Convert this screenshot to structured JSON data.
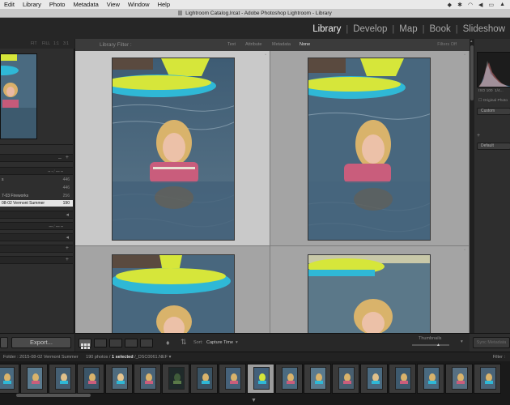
{
  "menubar": {
    "items": [
      "Edit",
      "Library",
      "Photo",
      "Metadata",
      "View",
      "Window",
      "Help"
    ]
  },
  "window": {
    "title": "Lightroom Catalog.lrcat - Adobe Photoshop Lightroom - Library"
  },
  "modules": [
    "Library",
    "Develop",
    "Map",
    "Book",
    "Slideshow"
  ],
  "active_module": "Library",
  "left_panel": {
    "folder_rows": [
      {
        "label": "s",
        "count": "446"
      },
      {
        "label": "",
        "count": "446"
      },
      {
        "label": "7-03 Fireworks",
        "count": "256"
      },
      {
        "label": "08-02 Vermont Summer",
        "count": "190",
        "selected": true
      }
    ]
  },
  "library_filter": {
    "label": "Library Filter :",
    "tabs": [
      "Text",
      "Attribute",
      "Metadata",
      "None"
    ],
    "active_tab": "None",
    "presets": "Filters Off"
  },
  "toolbar": {
    "sort_label": "Sort:",
    "sort_value": "Capture Time",
    "thumbnails_label": "Thumbnails"
  },
  "left_bottom": {
    "import_label": "",
    "export_label": "Export..."
  },
  "right_panel": {
    "histogram_values": [
      "ISO 100",
      "1/4..."
    ],
    "original_photo_label": "Original Photo",
    "custom_label": "Custom",
    "default_label": "Default",
    "sync_label": "Sync Metadata"
  },
  "filmstrip": {
    "folder_label": "Folder : 2015-08-02 Vermont Summer",
    "count_label": "190 photos /",
    "selected_label": "1 selected",
    "file_label": "/_DSC0061.NEF",
    "filter_label": "Filter :"
  },
  "colors": {
    "accent_active": "#f2f2f2",
    "panel_bg": "#2e2e2e",
    "grid_bg": "#a7a7a7",
    "pool_yellow": "#d6e63a",
    "pool_blue": "#2fb8d6",
    "water": "#4b6b83"
  }
}
